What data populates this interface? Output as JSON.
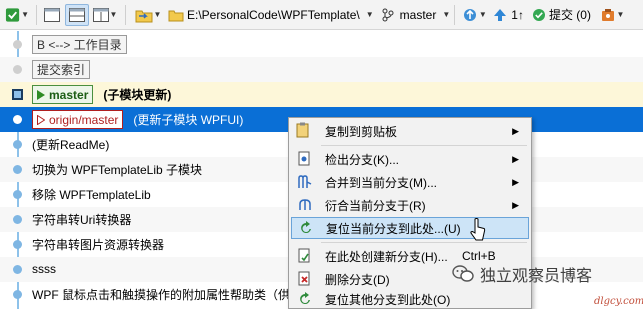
{
  "toolbar": {
    "repo_path": "E:\\PersonalCode\\WPFTemplate\\",
    "branch": "master",
    "up_count": "1↑",
    "commit_label": "提交 (0)"
  },
  "graph_rows": [
    {
      "kind": "tag",
      "tag_text": "B <--> 工作目录"
    },
    {
      "kind": "tag",
      "tag_text": "提交索引"
    },
    {
      "kind": "branch",
      "branch": "master",
      "message": "(子模块更新)"
    },
    {
      "kind": "remote",
      "branch": "origin/master",
      "message": "(更新子模块 WPFUI)"
    },
    {
      "kind": "commit",
      "message": "(更新ReadMe)"
    },
    {
      "kind": "commit",
      "message": "切换为 WPFTemplateLib 子模块"
    },
    {
      "kind": "commit",
      "message": "移除 WPFTemplateLib"
    },
    {
      "kind": "commit",
      "message": "字符串转Uri转换器"
    },
    {
      "kind": "commit",
      "message": "字符串转图片资源转换器"
    },
    {
      "kind": "commit",
      "message": "ssss"
    },
    {
      "kind": "commit",
      "message": "WPF 鼠标点击和触摸操作的附加属性帮助类（供"
    }
  ],
  "context_menu": {
    "items": [
      {
        "label": "复制到剪贴板",
        "shortcut": "",
        "submenu": true,
        "icon": "clipboard-icon"
      },
      {
        "label": "检出分支(K)...",
        "shortcut": "",
        "submenu": true,
        "icon": "checkout-icon"
      },
      {
        "label": "合并到当前分支(M)...",
        "shortcut": "",
        "submenu": true,
        "icon": "merge-icon"
      },
      {
        "label": "衍合当前分支于(R)",
        "shortcut": "",
        "submenu": true,
        "icon": "rebase-icon"
      },
      {
        "label": "复位当前分支到此处...(U)",
        "shortcut": "",
        "submenu": false,
        "icon": "reset-icon"
      },
      {
        "label": "在此处创建新分支(H)...",
        "shortcut": "Ctrl+B",
        "submenu": false,
        "icon": "new-branch-icon"
      },
      {
        "label": "删除分支(D)",
        "shortcut": "",
        "submenu": false,
        "icon": "delete-branch-icon"
      },
      {
        "label": "复位其他分支到此处(O)",
        "shortcut": "",
        "submenu": false,
        "icon": "reset-other-icon"
      }
    ]
  },
  "watermark": {
    "text": "独立观察员博客",
    "site": "dlgcy.com"
  },
  "colors": {
    "selection": "#0a6fd6",
    "graph_line": "#8ec2ea",
    "menu_hover": "#cde4f7"
  }
}
